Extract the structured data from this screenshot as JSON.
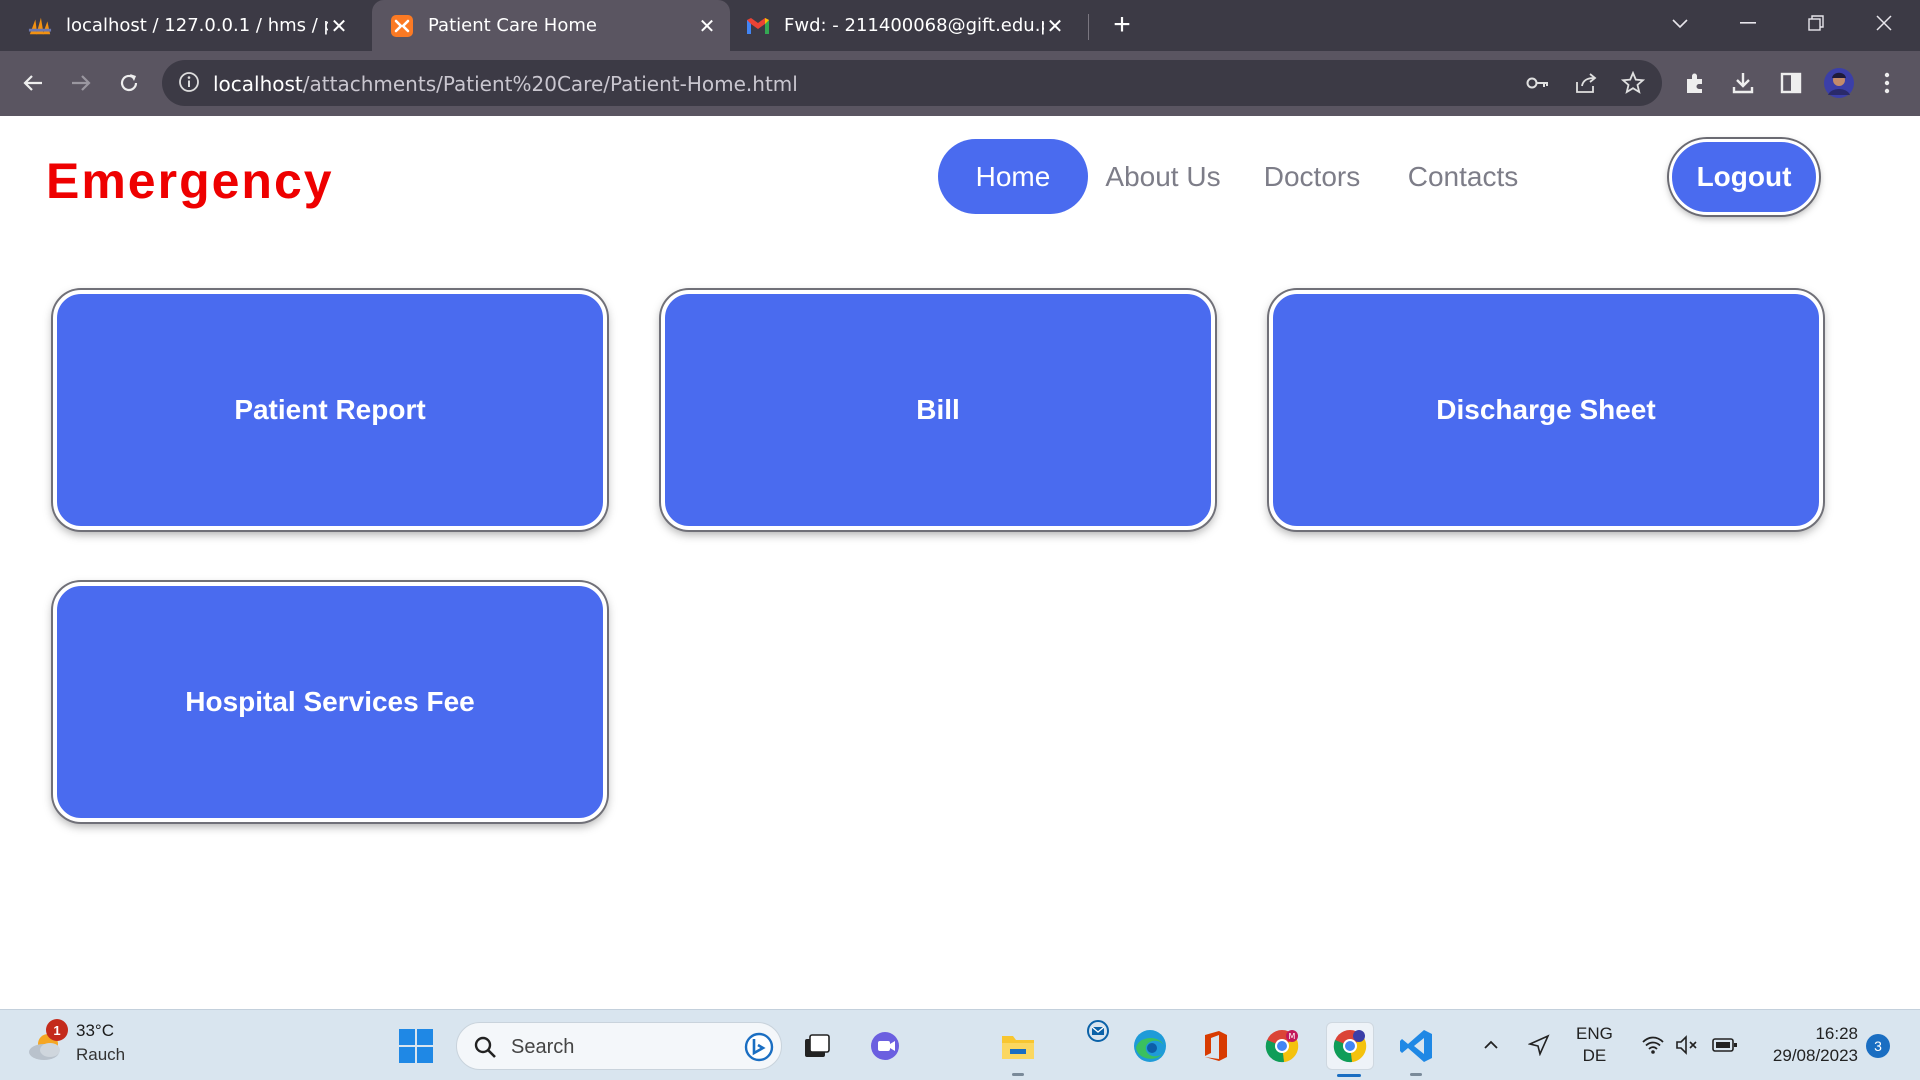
{
  "browser": {
    "tabs": [
      {
        "title": "localhost / 127.0.0.1 / hms / patie",
        "icon": "phpmyadmin-icon",
        "active": false
      },
      {
        "title": "Patient Care Home",
        "icon": "xampp-icon",
        "active": true
      },
      {
        "title": "Fwd: - 211400068@gift.edu.pk - ",
        "icon": "gmail-icon",
        "active": false
      }
    ],
    "url_host": "localhost",
    "url_path": "/attachments/Patient%20Care/Patient-Home.html"
  },
  "page": {
    "brand": "Emergency",
    "nav": [
      {
        "label": "Home",
        "active": true
      },
      {
        "label": "About Us",
        "active": false
      },
      {
        "label": "Doctors",
        "active": false
      },
      {
        "label": "Contacts",
        "active": false
      }
    ],
    "logout_label": "Logout",
    "cards": [
      {
        "label": "Patient Report"
      },
      {
        "label": "Bill"
      },
      {
        "label": "Discharge Sheet"
      },
      {
        "label": "Hospital Services Fee"
      }
    ],
    "accent_color": "#4a6bef",
    "brand_color": "#ee0000"
  },
  "taskbar": {
    "weather_temp": "33°C",
    "weather_desc": "Rauch",
    "weather_badge": "1",
    "search_placeholder": "Search",
    "lang_top": "ENG",
    "lang_bottom": "DE",
    "time": "16:28",
    "date": "29/08/2023",
    "notification_count": "3"
  }
}
